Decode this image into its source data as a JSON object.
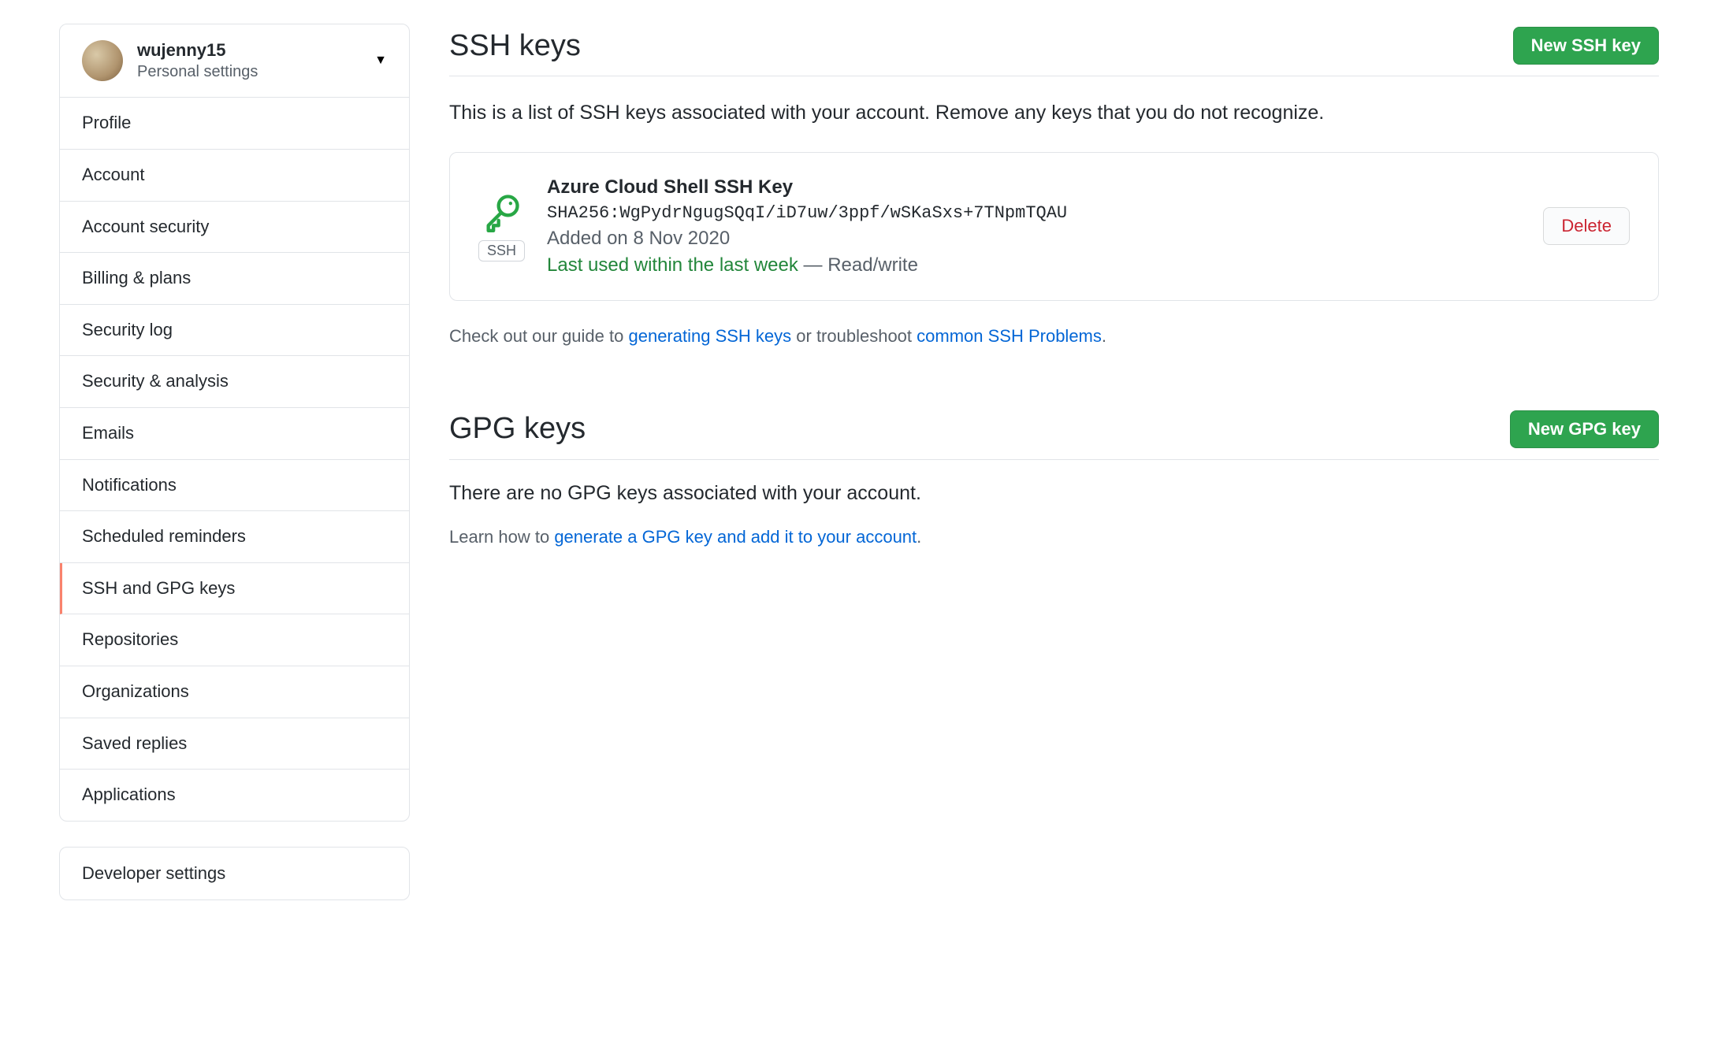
{
  "user": {
    "name": "wujenny15",
    "subtitle": "Personal settings"
  },
  "sidebar": {
    "items": [
      "Profile",
      "Account",
      "Account security",
      "Billing & plans",
      "Security log",
      "Security & analysis",
      "Emails",
      "Notifications",
      "Scheduled reminders",
      "SSH and GPG keys",
      "Repositories",
      "Organizations",
      "Saved replies",
      "Applications"
    ],
    "active_index": 9,
    "developer": "Developer settings"
  },
  "ssh": {
    "title": "SSH keys",
    "new_btn": "New SSH key",
    "desc": "This is a list of SSH keys associated with your account. Remove any keys that you do not recognize.",
    "keys": [
      {
        "name": "Azure Cloud Shell SSH Key",
        "fingerprint": "SHA256:WgPydrNgugSQqI/iD7uw/3ppf/wSKaSxs+7TNpmTQAU",
        "added": "Added on 8 Nov 2020",
        "last_used": "Last used within the last week",
        "perm_sep": " — ",
        "perm": "Read/write",
        "badge": "SSH",
        "delete_btn": "Delete"
      }
    ],
    "guide_pre": "Check out our guide to ",
    "guide_link": "generating SSH keys",
    "guide_mid": " or troubleshoot ",
    "problems_link": "common SSH Problems",
    "guide_end": "."
  },
  "gpg": {
    "title": "GPG keys",
    "new_btn": "New GPG key",
    "empty": "There are no GPG keys associated with your account.",
    "learn_pre": "Learn how to ",
    "learn_link": "generate a GPG key and add it to your account",
    "learn_end": "."
  }
}
